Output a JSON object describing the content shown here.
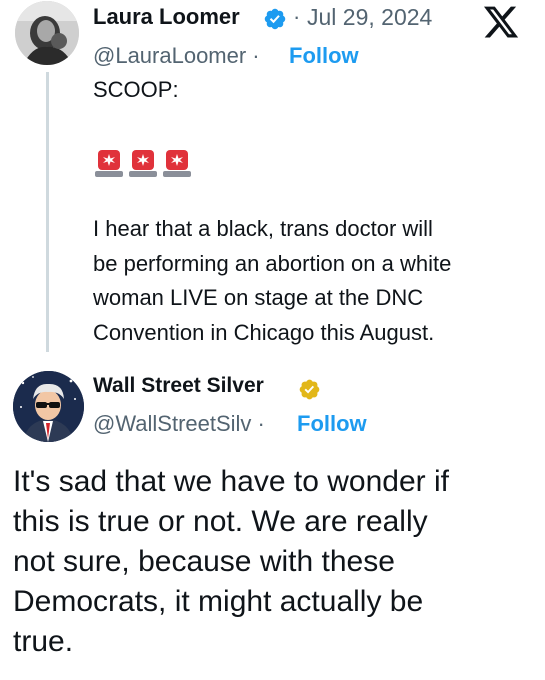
{
  "quoted_tweet": {
    "author_name": "Laura Loomer",
    "separator": "·",
    "date": "Jul 29, 2024",
    "handle": "@LauraLoomer ·",
    "follow_label": "Follow",
    "avatar_icon": "profile-photo",
    "platform_icon": "x-logo-icon",
    "text_first_line": "SCOOP:",
    "emoji": [
      "police-light-siren",
      "police-light-siren",
      "police-light-siren"
    ],
    "text_lines": [
      "I hear that a black, trans doctor will",
      "be performing an abortion on a white",
      "woman LIVE on stage at the DNC",
      "Convention in Chicago this August."
    ]
  },
  "reply_tweet": {
    "author_name": "Wall Street Silver",
    "handle": "@WallStreetSilv ·",
    "follow_label": "Follow",
    "avatar_icon": "cartoon-businessman-avatar",
    "text_lines": [
      "It's sad that we have to wonder if",
      "this is true or not. We are really",
      "not sure, because with these",
      "Democrats, it might actually be",
      "true."
    ]
  },
  "colors": {
    "link_blue": "#1d9bf0",
    "text": "#0f1419",
    "secondary_text": "#536471",
    "verified_blue": "#1d9bf0",
    "verified_gold": "#e2b719"
  }
}
